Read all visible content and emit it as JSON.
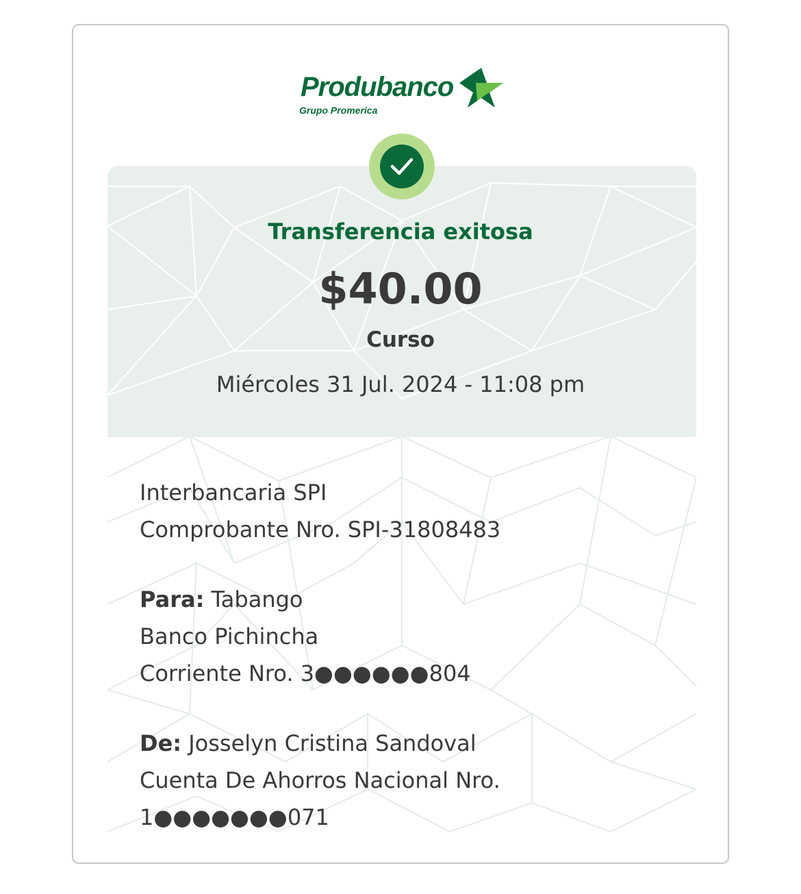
{
  "brand": {
    "name": "Produbanco",
    "subtitle": "Grupo Promerica",
    "logo_icon": "star-icon",
    "brand_color": "#0a6a3a",
    "accent_color": "#b8dc8e"
  },
  "status": {
    "icon": "check-icon",
    "title": "Transferencia exitosa"
  },
  "transfer": {
    "amount": "$40.00",
    "concept": "Curso",
    "datetime": "Miércoles 31 Jul. 2024 - 11:08 pm"
  },
  "details": {
    "type": "Interbancaria SPI",
    "voucher": "Comprobante Nro. SPI-31808483",
    "to_label": "Para:",
    "to_name": "Tabango",
    "to_bank": "Banco Pichincha",
    "to_account": "Corriente Nro. 3●●●●●●804",
    "from_label": "De:",
    "from_name": "Josselyn Cristina Sandoval",
    "from_account_type": "Cuenta De Ahorros Nacional Nro.",
    "from_account_number": "1●●●●●●●071"
  }
}
